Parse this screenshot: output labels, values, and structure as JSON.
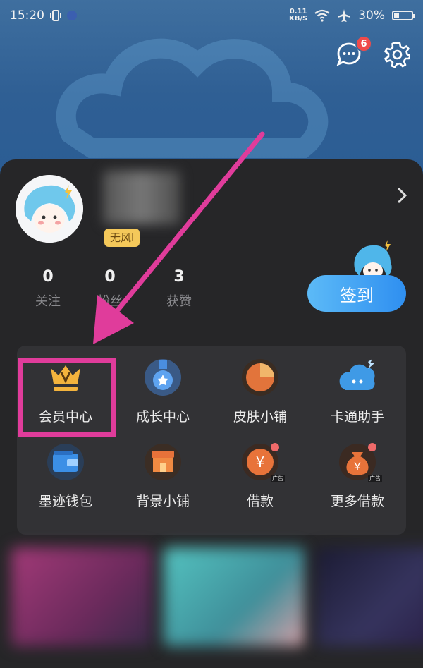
{
  "status": {
    "time": "15:20",
    "speed_top": "0.11",
    "speed_bottom": "KB/S",
    "battery": "30%",
    "battery_level": 0.3
  },
  "header": {
    "message_badge": "6"
  },
  "profile": {
    "level_tag": "无风I"
  },
  "stats": [
    {
      "value": "0",
      "label": "关注"
    },
    {
      "value": "0",
      "label": "粉丝"
    },
    {
      "value": "3",
      "label": "获赞"
    }
  ],
  "signin_label": "签到",
  "grid": [
    {
      "label": "会员中心",
      "icon": "crown-icon"
    },
    {
      "label": "成长中心",
      "icon": "medal-icon"
    },
    {
      "label": "皮肤小铺",
      "icon": "pie-icon"
    },
    {
      "label": "卡通助手",
      "icon": "cartoon-cloud-icon"
    },
    {
      "label": "墨迹钱包",
      "icon": "wallet-icon"
    },
    {
      "label": "背景小铺",
      "icon": "shop-icon"
    },
    {
      "label": "借款",
      "icon": "coin-icon",
      "ad": "广告"
    },
    {
      "label": "更多借款",
      "icon": "money-bag-icon",
      "ad": "广告"
    }
  ],
  "colors": {
    "highlight": "#e03c9b",
    "signin": "#3f9ff3",
    "background": "#262628"
  }
}
